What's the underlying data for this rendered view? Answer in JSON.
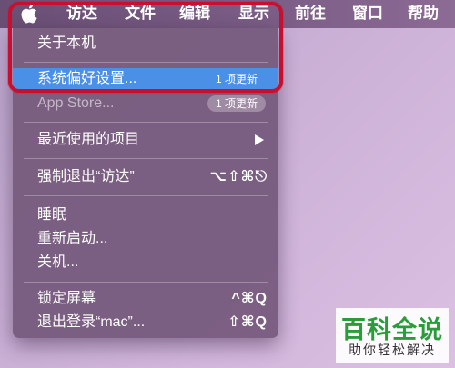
{
  "menubar": {
    "items": [
      "访达",
      "文件",
      "编辑",
      "显示",
      "前往",
      "窗口",
      "帮助"
    ]
  },
  "apple_menu": {
    "about": "关于本机",
    "system_prefs": {
      "label": "系统偏好设置...",
      "badge": "1 项更新"
    },
    "app_store": {
      "label": "App Store...",
      "badge": "1 项更新"
    },
    "recent_items": "最近使用的项目",
    "force_quit": {
      "label": "强制退出“访达”",
      "shortcut": "⌥⇧⌘⎋"
    },
    "sleep": "睡眠",
    "restart": "重新启动...",
    "shutdown": "关机...",
    "lock_screen": {
      "label": "锁定屏幕",
      "shortcut": "^⌘Q"
    },
    "logout": {
      "label": "退出登录“mac”...",
      "shortcut": "⇧⌘Q"
    }
  },
  "watermark": {
    "title": "百科全说",
    "subtitle": "助你轻松解决"
  },
  "colors": {
    "highlight": "#4a90e6",
    "annotation_frame": "#c8102e",
    "watermark_green": "#2a9d3a"
  }
}
